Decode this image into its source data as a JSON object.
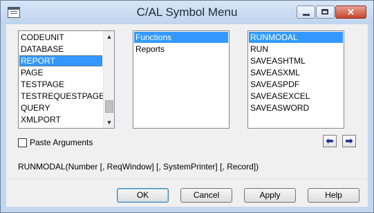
{
  "window": {
    "title": "C/AL Symbol Menu"
  },
  "titlebar": {
    "minimize_icon": "minimize-icon",
    "maximize_icon": "maximize-icon",
    "close_icon": "close-icon",
    "close_glyph": "✕"
  },
  "types_list": {
    "items": [
      "CODEUNIT",
      "DATABASE",
      "REPORT",
      "PAGE",
      "TESTPAGE",
      "TESTREQUESTPAGE",
      "QUERY",
      "XMLPORT"
    ],
    "selected": "REPORT",
    "scroll_up_glyph": "▲",
    "scroll_down_glyph": "▼"
  },
  "groups_list": {
    "items": [
      "Functions",
      "Reports"
    ],
    "selected": "Functions"
  },
  "members_list": {
    "items": [
      "RUNMODAL",
      "RUN",
      "SAVEASHTML",
      "SAVEASXML",
      "SAVEASPDF",
      "SAVEASEXCEL",
      "SAVEASWORD"
    ],
    "selected": "RUNMODAL"
  },
  "paste_arguments": {
    "label": "Paste Arguments",
    "checked": false
  },
  "nav": {
    "left_glyph": "⬅",
    "right_glyph": "➡"
  },
  "syntax": "RUNMODAL(Number [, ReqWindow] [, SystemPrinter] [, Record])",
  "buttons": {
    "ok": "OK",
    "cancel": "Cancel",
    "apply": "Apply",
    "help": "Help"
  },
  "colors": {
    "selection": "#3399ff",
    "titlebar": "#c3d6ec",
    "close_button": "#c7442c"
  }
}
